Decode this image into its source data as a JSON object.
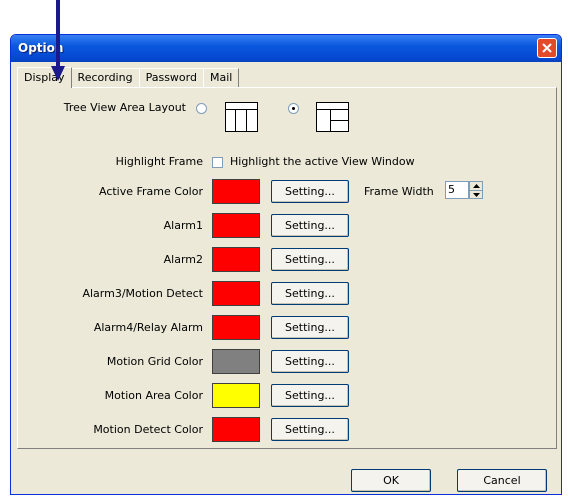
{
  "window": {
    "title": "Option",
    "close_icon": "close-icon"
  },
  "tabs": [
    {
      "label": "Display",
      "active": true
    },
    {
      "label": "Recording",
      "active": false
    },
    {
      "label": "Password",
      "active": false
    },
    {
      "label": "Mail",
      "active": false
    }
  ],
  "display": {
    "tree_view_layout": {
      "label": "Tree View Area Layout",
      "selected_option": 2
    },
    "highlight_frame": {
      "label": "Highlight Frame",
      "checkbox_label": "Highlight the active View Window",
      "checked": false
    },
    "frame_width": {
      "label": "Frame Width",
      "value": "5"
    },
    "setting_label": "Setting...",
    "colors": [
      {
        "label": "Active Frame Color",
        "color": "#ff0000"
      },
      {
        "label": "Alarm1",
        "color": "#ff0000"
      },
      {
        "label": "Alarm2",
        "color": "#ff0000"
      },
      {
        "label": "Alarm3/Motion Detect",
        "color": "#ff0000"
      },
      {
        "label": "Alarm4/Relay Alarm",
        "color": "#ff0000"
      },
      {
        "label": "Motion Grid Color",
        "color": "#808080"
      },
      {
        "label": "Motion Area Color",
        "color": "#ffff00"
      },
      {
        "label": "Motion Detect Color",
        "color": "#ff0000"
      }
    ]
  },
  "footer": {
    "ok_label": "OK",
    "cancel_label": "Cancel"
  }
}
